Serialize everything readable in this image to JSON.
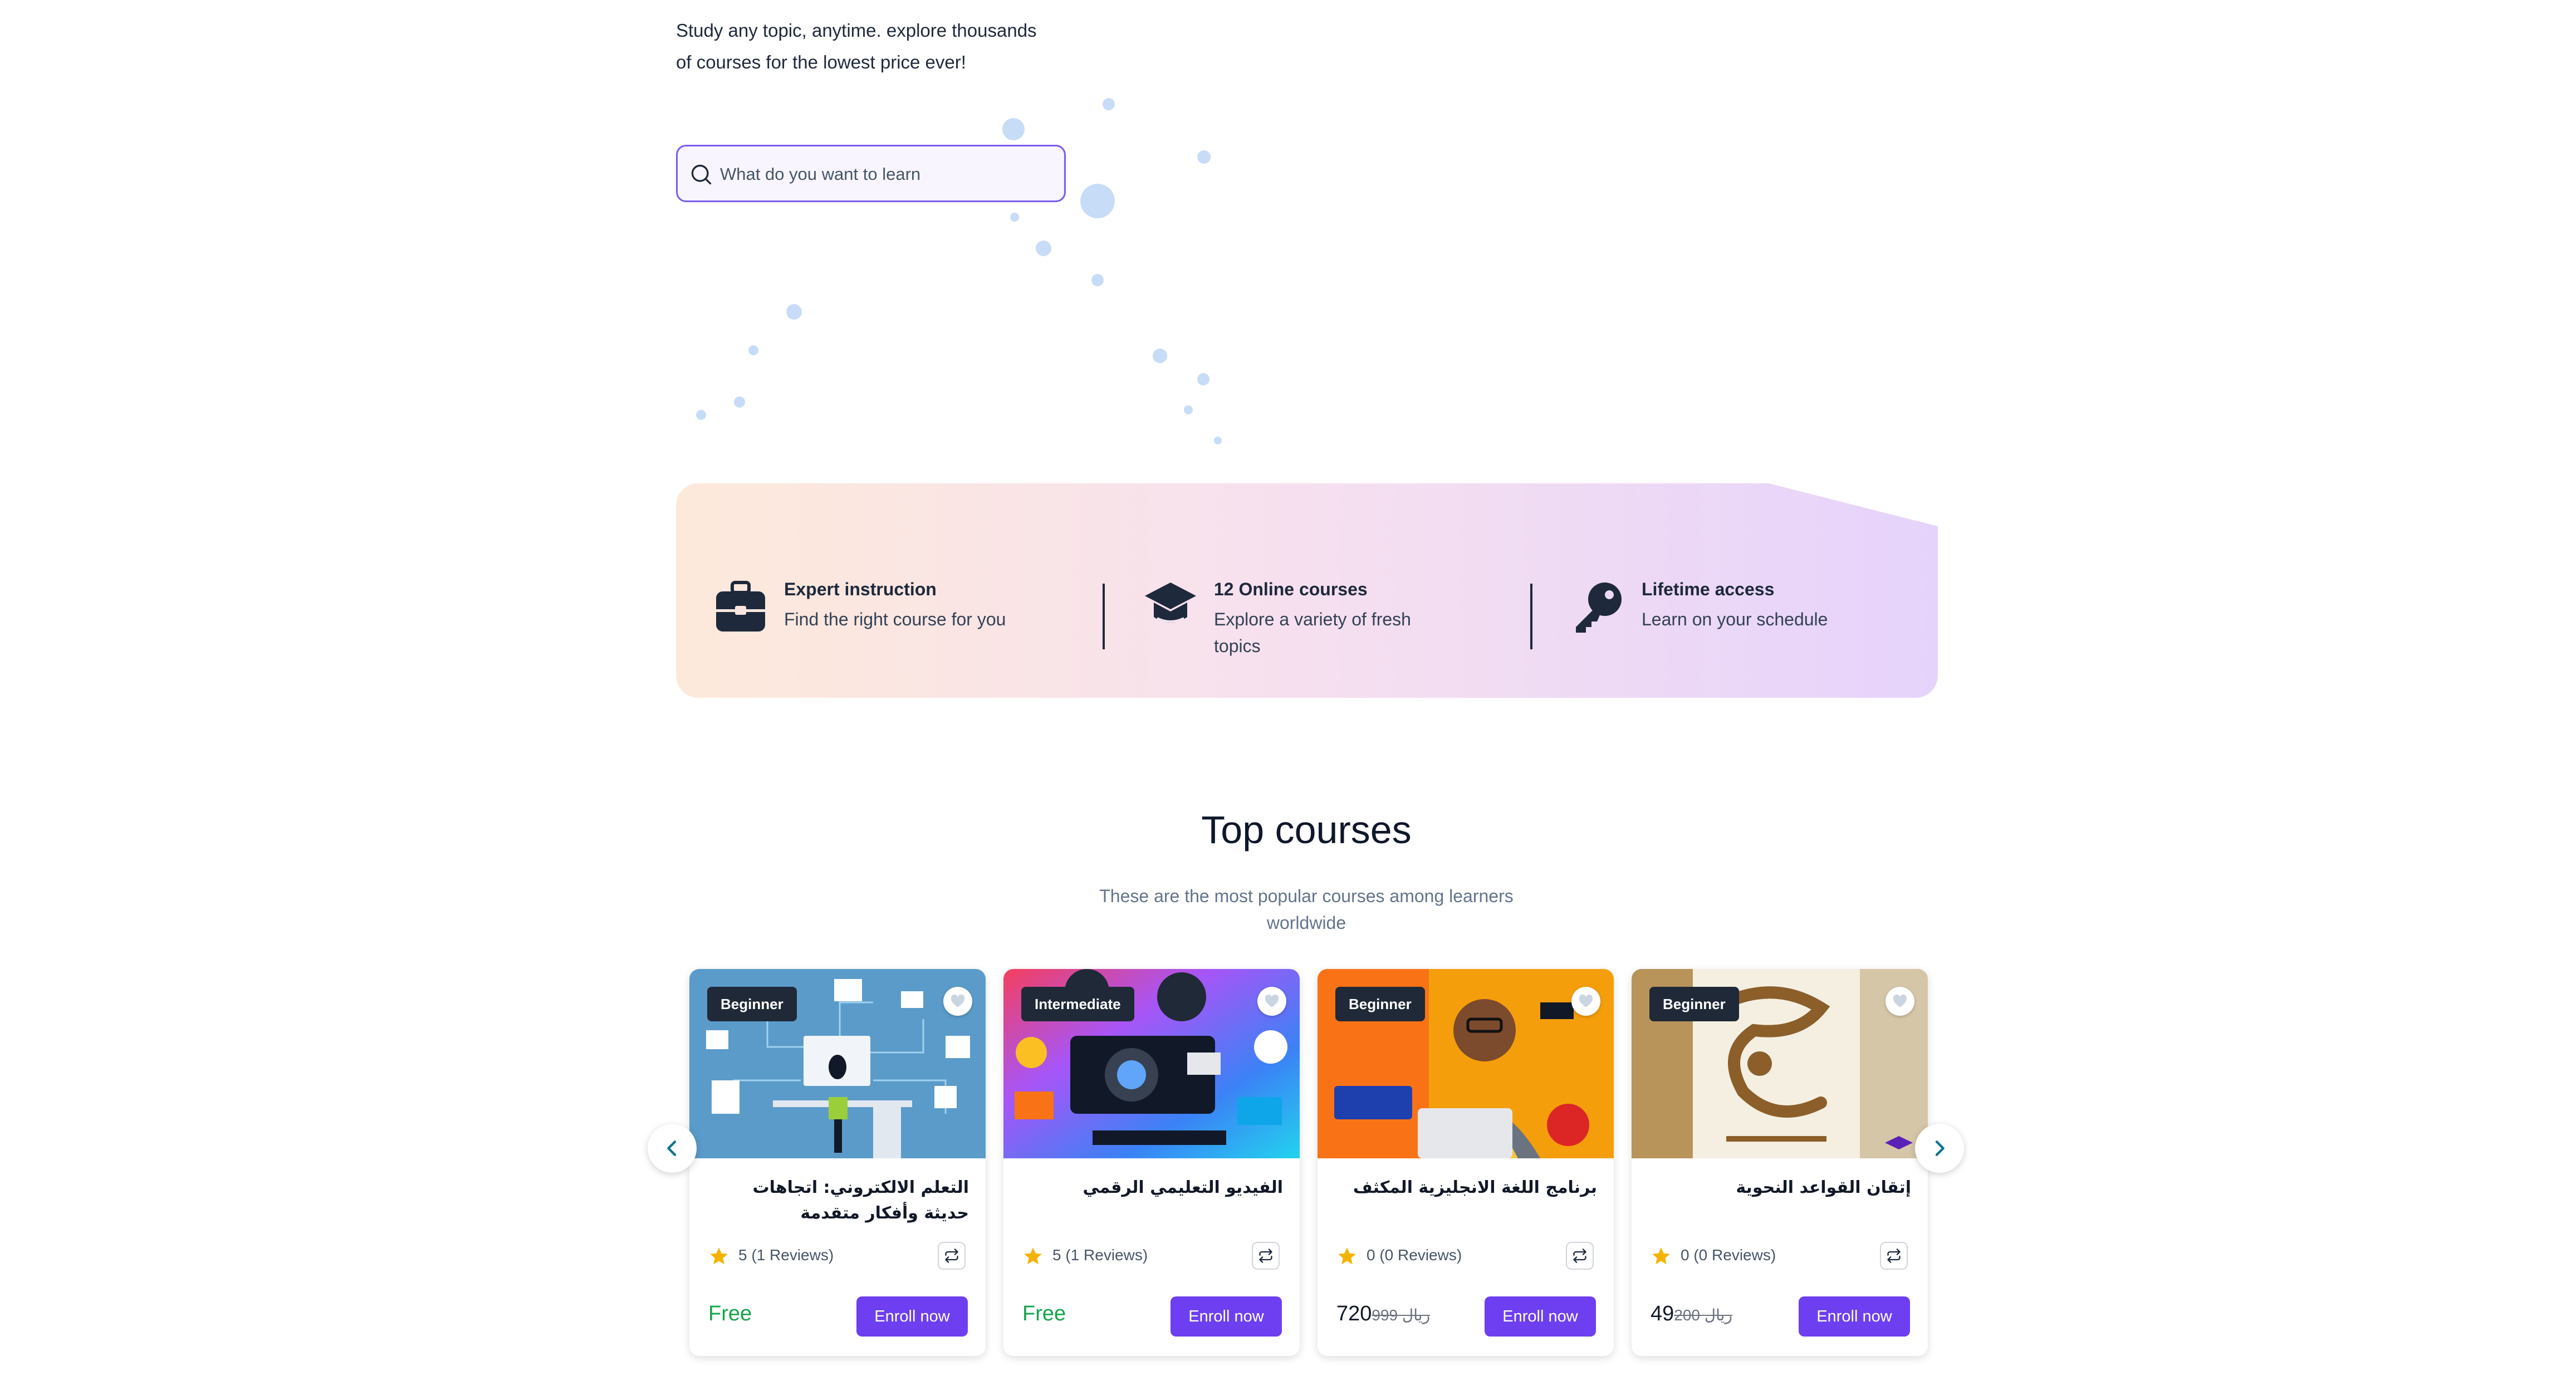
{
  "hero": {
    "line1": "Study any topic, anytime. explore thousands",
    "line2": "of courses for the lowest price ever!"
  },
  "search": {
    "placeholder": "What do you want to learn",
    "icon": "search-icon"
  },
  "features": [
    {
      "icon": "briefcase-icon",
      "title": "Expert instruction",
      "description": "Find the right course for you"
    },
    {
      "icon": "graduation-cap-icon",
      "title": "12 Online courses",
      "description": "Explore a variety of fresh topics"
    },
    {
      "icon": "key-icon",
      "title": "Lifetime access",
      "description": "Learn on your schedule"
    }
  ],
  "top_courses": {
    "title": "Top courses",
    "subtitle_line1": "These are the most popular courses among learners",
    "subtitle_line2": "worldwide",
    "enroll_label": "Enroll now",
    "courses": [
      {
        "level": "Beginner",
        "title": "التعلم الالكتروني: اتجاهات حديثة وأفكار متقدمة",
        "rating": "5",
        "reviews": "(1 Reviews)",
        "price": "Free",
        "old_price": "",
        "currency": ""
      },
      {
        "level": "Intermediate",
        "title": "الفيديو التعليمي الرقمي",
        "rating": "5",
        "reviews": "(1 Reviews)",
        "price": "Free",
        "old_price": "",
        "currency": ""
      },
      {
        "level": "Beginner",
        "title": "برنامج اللغة الانجليزية المكثف",
        "rating": "0",
        "reviews": "(0 Reviews)",
        "price": "720",
        "old_price": "999",
        "currency": "ريال"
      },
      {
        "level": "Beginner",
        "title": "إتقان القواعد النحوية",
        "rating": "0",
        "reviews": "(0 Reviews)",
        "price": "49",
        "old_price": "200",
        "currency": "ريال"
      }
    ]
  },
  "colors": {
    "accent": "#6d3ff0",
    "free": "#16a34a",
    "star": "#f5b301",
    "arrow": "#0e7490"
  }
}
